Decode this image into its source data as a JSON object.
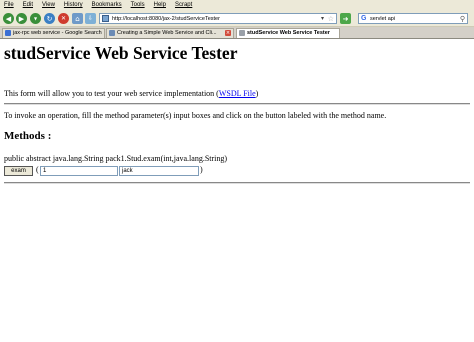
{
  "menu": [
    "File",
    "Edit",
    "View",
    "History",
    "Bookmarks",
    "Tools",
    "Help",
    "Scrapt"
  ],
  "nav": {
    "url": "http://localhost:8080/jax-2/studServiceTester",
    "search": "servlet api"
  },
  "tabs": [
    {
      "label": "jax-rpc web service - Google Search",
      "icon_color": "#3b6fd4",
      "active": false
    },
    {
      "label": "Creating a Simple Web Service and Cli...",
      "icon_color": "#6b8bb5",
      "active": false
    },
    {
      "label": "studService Web Service Tester",
      "icon_color": "#9aa0a8",
      "active": true
    }
  ],
  "page": {
    "title": "studService Web Service Tester",
    "intro_before": "This form will allow you to test your web service implementation (",
    "wsdl_link": "WSDL File",
    "intro_after": ")",
    "instructions": "To invoke an operation, fill the method parameter(s) input boxes and click on the button labeled with the method name.",
    "methods_heading": "Methods :",
    "signature": "public abstract java.lang.String pack1.Stud.exam(int,java.lang.String)",
    "method_button": "exam",
    "open_paren": "(",
    "close_paren": ")",
    "param1_value": "1",
    "param2_value": "jack"
  }
}
